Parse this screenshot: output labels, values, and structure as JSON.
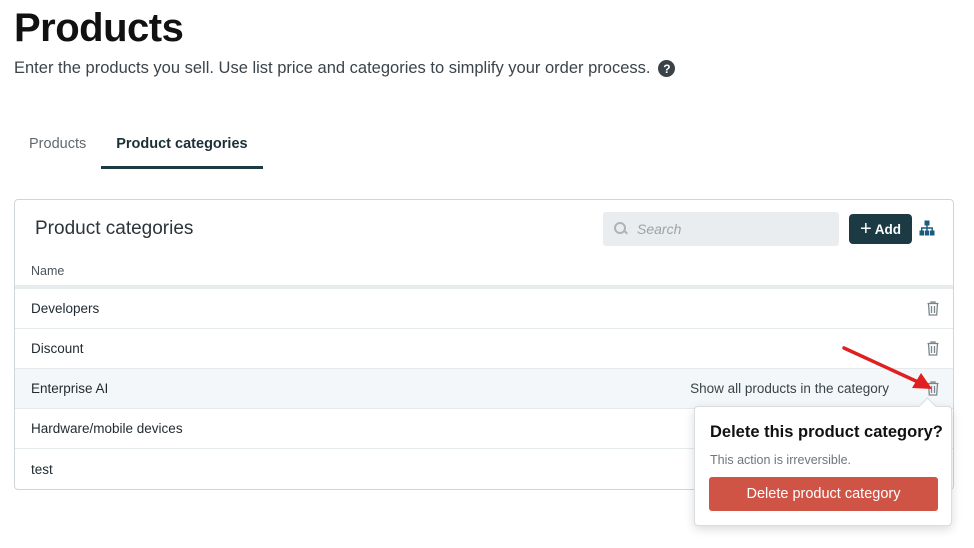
{
  "header": {
    "title": "Products",
    "subtitle": "Enter the products you sell. Use list price and categories to simplify your order process.",
    "help_glyph": "?"
  },
  "tabs": [
    {
      "label": "Products",
      "active": false
    },
    {
      "label": "Product categories",
      "active": true
    }
  ],
  "panel": {
    "title": "Product categories",
    "search_placeholder": "Search",
    "add_label": "Add",
    "column_name": "Name",
    "rows": [
      {
        "name": "Developers"
      },
      {
        "name": "Discount"
      },
      {
        "name": "Enterprise AI",
        "hover_text": "Show all products in the category"
      },
      {
        "name": "Hardware/mobile devices"
      },
      {
        "name": "test"
      }
    ]
  },
  "popover": {
    "title": "Delete this product category?",
    "text": "This action is irreversible.",
    "button_label": "Delete product category"
  },
  "colors": {
    "primary": "#1c3a44",
    "danger": "#cf5446",
    "annotation_arrow": "#e02020"
  },
  "icons": [
    "help-icon",
    "search-icon",
    "plus-icon",
    "hierarchy-icon",
    "trash-icon"
  ]
}
